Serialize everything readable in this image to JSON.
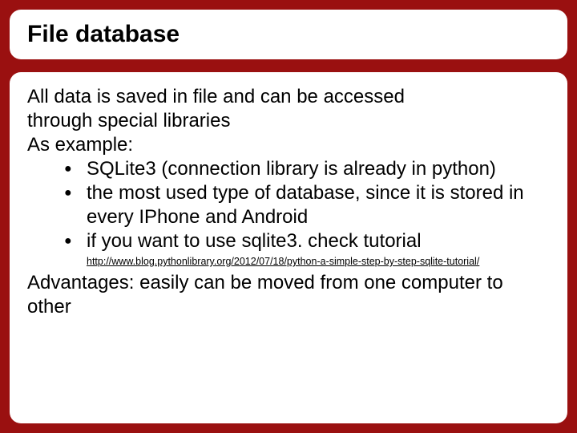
{
  "title": "File database",
  "intro_line1": "All data is saved in file and can be accessed",
  "intro_line2": "through special libraries",
  "intro_line3": "As example:",
  "bullets": [
    "SQLite3 (connection library is already in python)",
    "the most used type of database, since it is stored in every IPhone and Android",
    "if you want to use sqlite3. check tutorial"
  ],
  "tutorial_link": "http://www.blog.pythonlibrary.org/2012/07/18/python-a-simple-step-by-step-sqlite-tutorial/",
  "advantages": "Advantages: easily can be moved from one computer to other"
}
